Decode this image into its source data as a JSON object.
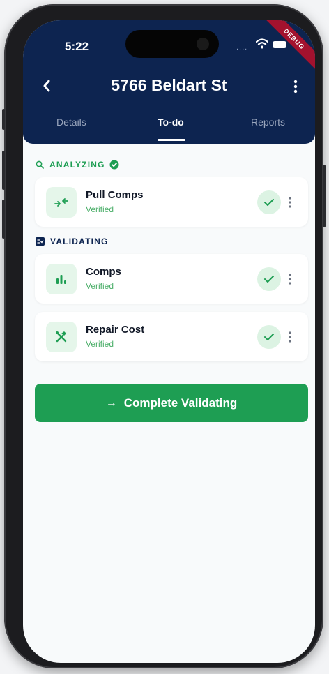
{
  "status_bar": {
    "time": "5:22",
    "signal_dots": "....",
    "debug_label": "DEBUG"
  },
  "header": {
    "title": "5766 Beldart St",
    "tabs": [
      {
        "label": "Details"
      },
      {
        "label": "To-do",
        "active": true
      },
      {
        "label": "Reports"
      }
    ]
  },
  "sections": {
    "analyzing": {
      "label": "ANALYZING",
      "items": [
        {
          "name": "Pull Comps",
          "status": "Verified",
          "icon": "arrows-converge-icon"
        }
      ]
    },
    "validating": {
      "label": "VALIDATING",
      "items": [
        {
          "name": "Comps",
          "status": "Verified",
          "icon": "bar-chart-icon"
        },
        {
          "name": "Repair Cost",
          "status": "Verified",
          "icon": "tools-icon"
        }
      ]
    }
  },
  "cta": {
    "label": "Complete Validating"
  },
  "colors": {
    "navy": "#0d2450",
    "green": "#1e9e53",
    "light_green": "#e5f6ea"
  }
}
